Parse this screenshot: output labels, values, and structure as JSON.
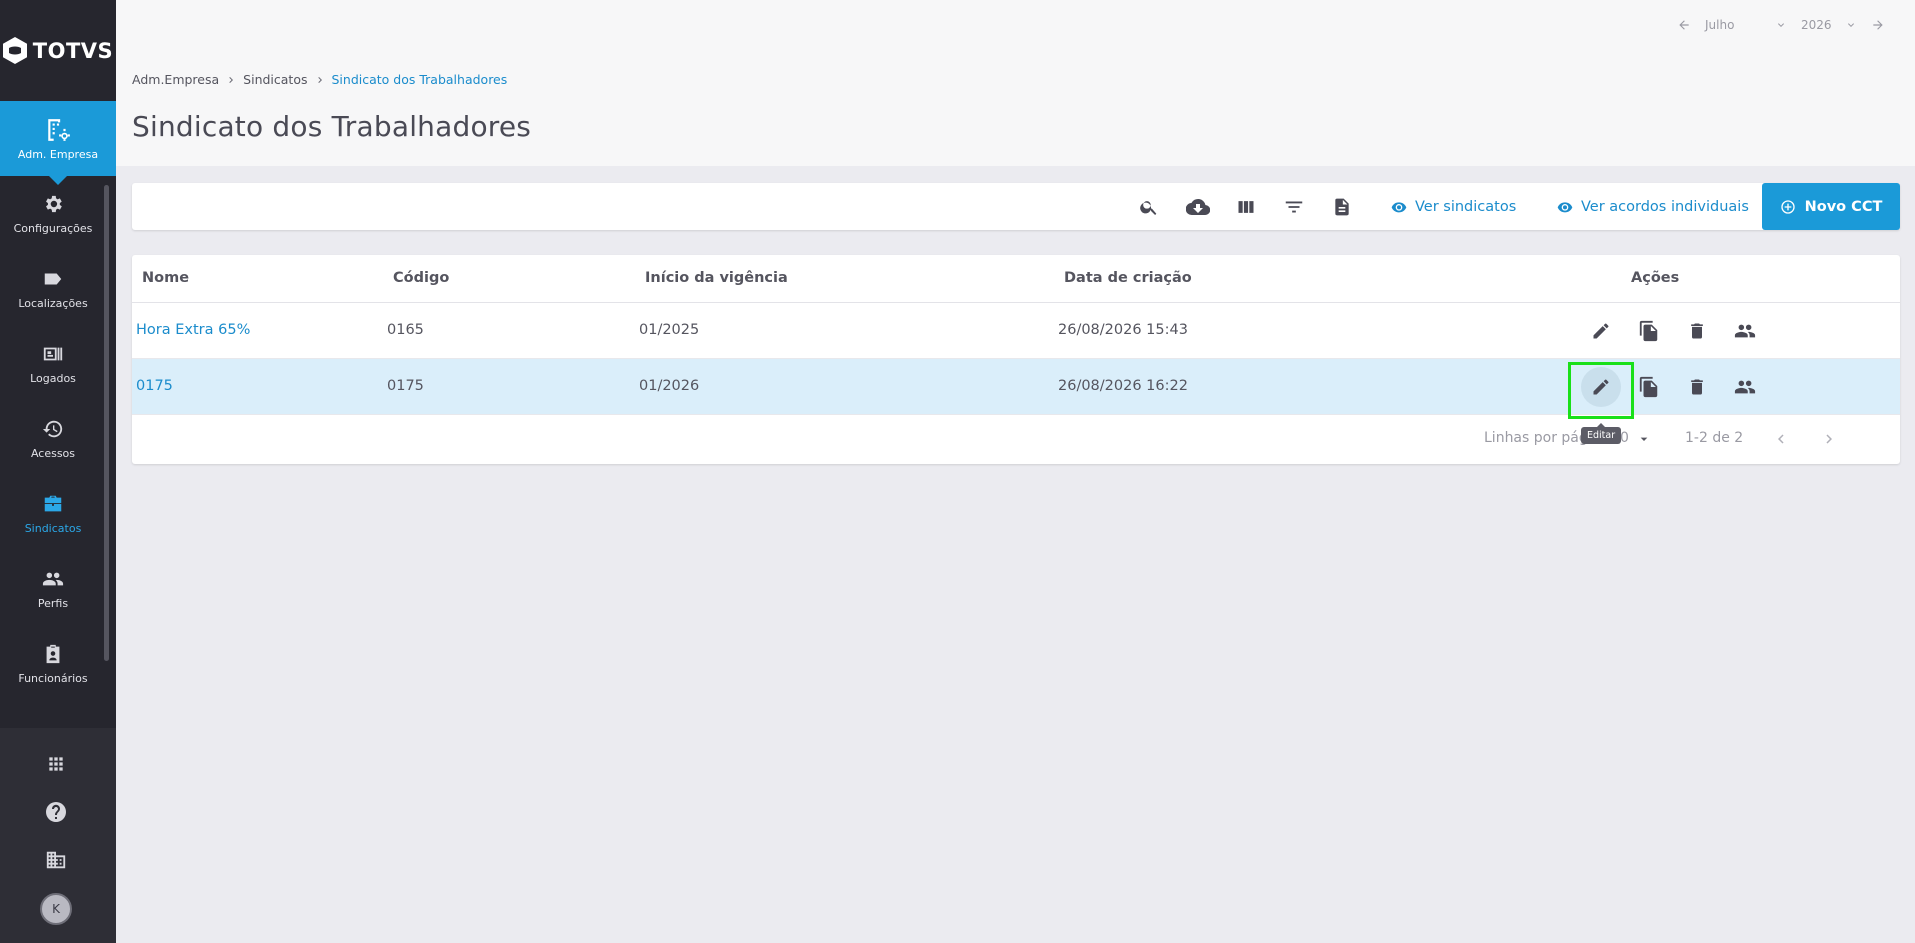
{
  "brand": {
    "name": "TOTVS"
  },
  "sidebar": {
    "active": {
      "label": "Adm. Empresa",
      "icon": "building-settings-icon"
    },
    "items": [
      {
        "label": "Configurações",
        "icon": "gear-icon"
      },
      {
        "label": "Localizações",
        "icon": "tag-icon"
      },
      {
        "label": "Logados",
        "icon": "badge-icon"
      },
      {
        "label": "Acessos",
        "icon": "history-icon"
      },
      {
        "label": "Sindicatos",
        "icon": "briefcase-icon",
        "selected": true
      },
      {
        "label": "Perfis",
        "icon": "people-icon"
      },
      {
        "label": "Funcionários",
        "icon": "clipboard-user-icon"
      }
    ],
    "bottom": [
      "apps-grid-icon",
      "help-icon",
      "company-icon"
    ],
    "avatar_initial": "K"
  },
  "period": {
    "month": "Julho",
    "year": "2026"
  },
  "breadcrumb": [
    "Adm.Empresa",
    "Sindicatos",
    "Sindicato dos Trabalhadores"
  ],
  "page_title": "Sindicato dos Trabalhadores",
  "toolbar": {
    "icons": [
      "search-icon",
      "cloud-download-icon",
      "columns-icon",
      "filter-icon",
      "document-icon"
    ],
    "ver_sindicatos": "Ver sindicatos",
    "ver_acordos": "Ver acordos individuais",
    "novo_cct": "Novo CCT"
  },
  "table": {
    "headers": {
      "nome": "Nome",
      "codigo": "Código",
      "inicio": "Início da vigência",
      "data": "Data de criação",
      "acoes": "Ações"
    },
    "rows": [
      {
        "nome": "Hora Extra 65%",
        "codigo": "0165",
        "inicio": "01/2025",
        "data": "26/08/2026 15:43"
      },
      {
        "nome": "0175",
        "codigo": "0175",
        "inicio": "01/2026",
        "data": "26/08/2026 16:22"
      }
    ],
    "actions": [
      "edit-icon",
      "copy-icon",
      "delete-icon",
      "people-icon"
    ],
    "footer": {
      "rows_per_page_label": "Linhas por pág",
      "rows_per_page_suffix": "0",
      "range": "1-2 de 2"
    }
  },
  "tooltip": "Editar",
  "colors": {
    "accent": "#1b9ad8",
    "sidebar": "#26262e",
    "highlight_row": "#daeefa",
    "focus": "#19e019"
  }
}
